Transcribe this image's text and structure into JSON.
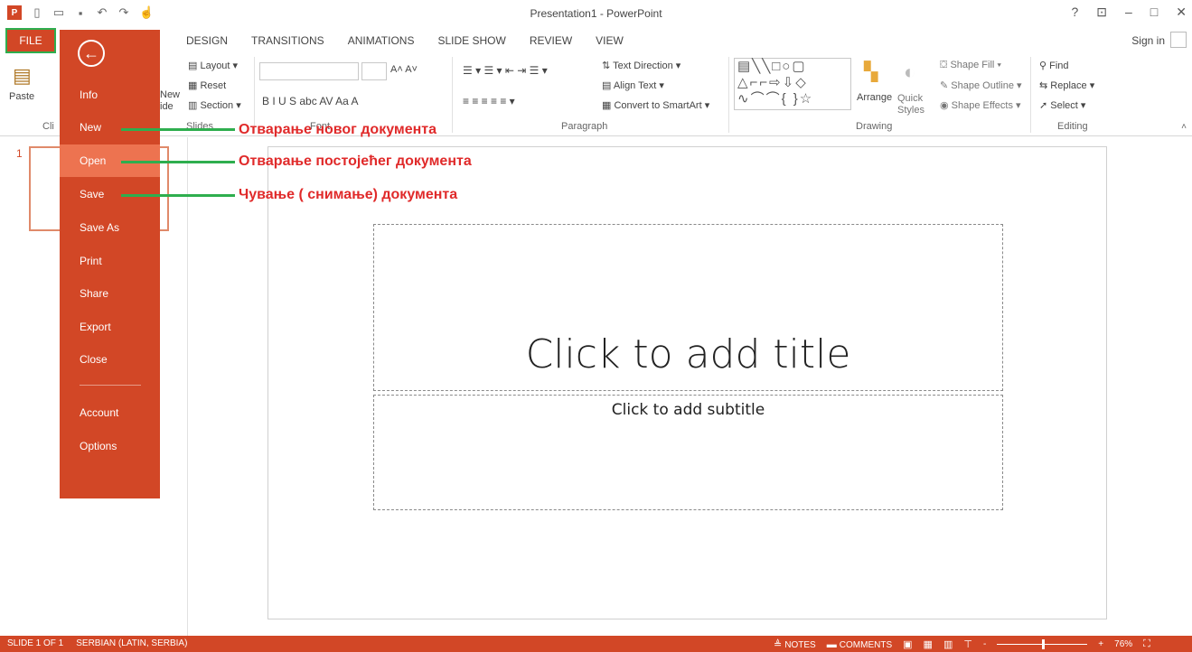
{
  "app": {
    "window_title": "Presentation1 - PowerPoint",
    "logo_text": "P",
    "qat_icons": [
      "new-icon",
      "open-icon",
      "save-icon",
      "undo-icon",
      "redo-icon",
      "touch-mode-icon"
    ],
    "help": "?",
    "restore_ribbon": "⊡",
    "minimize": "–",
    "maximize": "□",
    "close": "✕"
  },
  "tabs": {
    "file": "FILE",
    "items": [
      "DESIGN",
      "TRANSITIONS",
      "ANIMATIONS",
      "SLIDE SHOW",
      "REVIEW",
      "VIEW"
    ],
    "sign_in": "Sign in"
  },
  "ribbon": {
    "paste": "Paste",
    "clipboard_label": "Cli",
    "new_slide_label_1": "New",
    "new_slide_label_2": "ide",
    "layout": "Layout",
    "reset": "Reset",
    "section": "Section",
    "slides_label": "Slides",
    "font_label": "Font",
    "paragraph_label": "Paragraph",
    "text_direction": "Text Direction",
    "align_text": "Align Text",
    "convert_smartart": "Convert to SmartArt",
    "drawing_label": "Drawing",
    "arrange": "Arrange",
    "quick_styles_1": "Quick",
    "quick_styles_2": "Styles",
    "shape_fill": "Shape Fill",
    "shape_outline": "Shape Outline",
    "shape_effects": "Shape Effects",
    "find": "Find",
    "replace": "Replace",
    "select": "Select",
    "editing_label": "Editing",
    "font_buttons": "B  I  U  S  abc  AV  Aa  A"
  },
  "backstage": {
    "items": [
      {
        "label": "Info",
        "active": false
      },
      {
        "label": "New",
        "active": false
      },
      {
        "label": "Open",
        "active": true
      },
      {
        "label": "Save",
        "active": false
      },
      {
        "label": "Save As",
        "active": false
      },
      {
        "label": "Print",
        "active": false
      },
      {
        "label": "Share",
        "active": false
      },
      {
        "label": "Export",
        "active": false
      },
      {
        "label": "Close",
        "active": false
      }
    ],
    "bottom_items": [
      "Account",
      "Options"
    ]
  },
  "annotations": [
    {
      "text": "Отварање нoвог документа"
    },
    {
      "text": "Отварање постојећег документа"
    },
    {
      "text": "Чување ( снимање) документа"
    }
  ],
  "thumbnail": {
    "number": "1"
  },
  "slide": {
    "title_placeholder": "Click to add title",
    "subtitle_placeholder": "Click to add subtitle"
  },
  "status": {
    "slide_info": "SLIDE 1 OF 1",
    "language": "SERBIAN (LATIN, SERBIA)",
    "notes": "NOTES",
    "comments": "COMMENTS",
    "zoom": "76%",
    "zoom_level": 0.5,
    "minus": "-",
    "plus": "+"
  },
  "colors": {
    "accent": "#d24726",
    "active_menu": "#ed7350",
    "annotation_line": "#2eae4e",
    "annotation_text": "#e02a2a"
  }
}
